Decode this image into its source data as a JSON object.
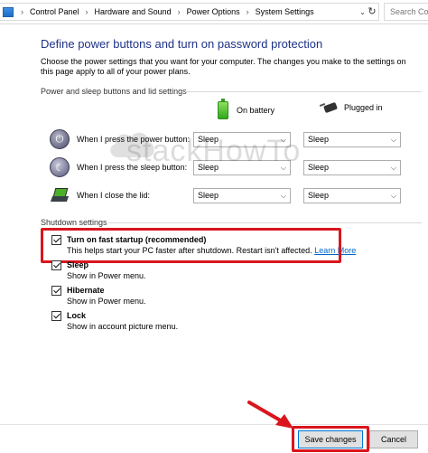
{
  "addressbar": {
    "segments": [
      "Control Panel",
      "Hardware and Sound",
      "Power Options",
      "System Settings"
    ],
    "search_placeholder": "Search Co"
  },
  "page": {
    "title": "Define power buttons and turn on password protection",
    "intro": "Choose the power settings that you want for your computer. The changes you make to the settings on this page apply to all of your power plans."
  },
  "power_section": {
    "label": "Power and sleep buttons and lid settings",
    "col_battery": "On battery",
    "col_plugged": "Plugged in",
    "rows": [
      {
        "label": "When I press the power button:",
        "battery": "Sleep",
        "plugged": "Sleep"
      },
      {
        "label": "When I press the sleep button:",
        "battery": "Sleep",
        "plugged": "Sleep"
      },
      {
        "label": "When I close the lid:",
        "battery": "Sleep",
        "plugged": "Sleep"
      }
    ]
  },
  "shutdown_section": {
    "label": "Shutdown settings",
    "items": [
      {
        "title": "Turn on fast startup (recommended)",
        "desc": "This helps start your PC faster after shutdown. Restart isn't affected.",
        "link": "Learn More",
        "checked": true
      },
      {
        "title": "Sleep",
        "desc": "Show in Power menu.",
        "checked": true
      },
      {
        "title": "Hibernate",
        "desc": "Show in Power menu.",
        "checked": true
      },
      {
        "title": "Lock",
        "desc": "Show in account picture menu.",
        "checked": true
      }
    ]
  },
  "footer": {
    "save_label": "Save changes",
    "cancel_label": "Cancel"
  },
  "watermark": "stackHowTo",
  "colors": {
    "title": "#1e3287",
    "highlight": "#d9161e",
    "link": "#0066cc"
  }
}
